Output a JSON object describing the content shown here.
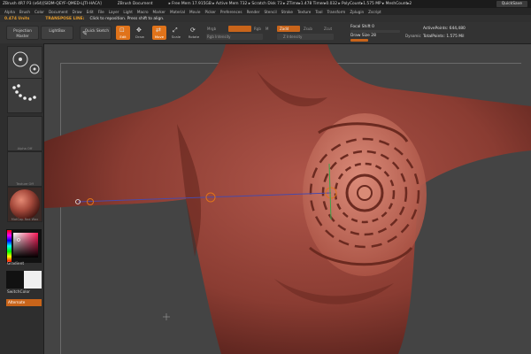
{
  "titlebar": {
    "title": "ZBrush 4R7 P3 (x64)[SIDM-QEYF-QMED-LJTI-HACA]",
    "document": "ZBrush Document",
    "memory": "▸ Free Mem 17.915GB ▸ Active Mem 732 ▸ Scratch Disk 73 ▸ ZTime▸1.478 Timer▸0.032 ▸ PolyCount▸1.575 MP ▸ MeshCount▸2",
    "quicksave": "QuickSave"
  },
  "menu": [
    "Alpha",
    "Brush",
    "Color",
    "Document",
    "Draw",
    "Edit",
    "File",
    "Layer",
    "Light",
    "Macro",
    "Marker",
    "Material",
    "Movie",
    "Picker",
    "Preferences",
    "Render",
    "Stencil",
    "Stroke",
    "Texture",
    "Tool",
    "Transform",
    "Zplugin",
    "Zscript"
  ],
  "status": {
    "units": "0.474 Units",
    "line": "TRANSPOSE LINE:",
    "hint": "Click to reposition. Press shift to align."
  },
  "toolbar": {
    "projection_master": "Projection Master",
    "lightbox": "LightBox",
    "quick_sketch": "Quick Sketch",
    "edit": "Edit",
    "draw": "Draw",
    "move": "Move",
    "scale": "Scale",
    "rotate": "Rotate",
    "mrgb_label": "Mrgb",
    "rgb_label": "Rgb",
    "m_label": "M",
    "zadd_label": "Zadd",
    "zsub_label": "Zsub",
    "zcut_label": "Zcut",
    "rgb_intensity": "Rgb Intensity",
    "z_intensity": "Z Intensity",
    "focal_shift": "Focal Shift 0",
    "draw_size": "Draw Size 28",
    "dynamic": "Dynamic",
    "active_points": "ActivePoints: 644,480",
    "total_points": "TotalPoints: 1.575 Mil"
  },
  "shelf": {
    "thumb_labels": [
      "",
      "",
      "Alpha Off",
      "Texture Off",
      "MatCap Red Wax"
    ],
    "gradient": "Gradient",
    "switchcolor": "SwitchColor",
    "alternate": "Alternate"
  },
  "colors": {
    "accent": "#e0731a",
    "skin": "#9e4a3c",
    "background": "#444444"
  }
}
